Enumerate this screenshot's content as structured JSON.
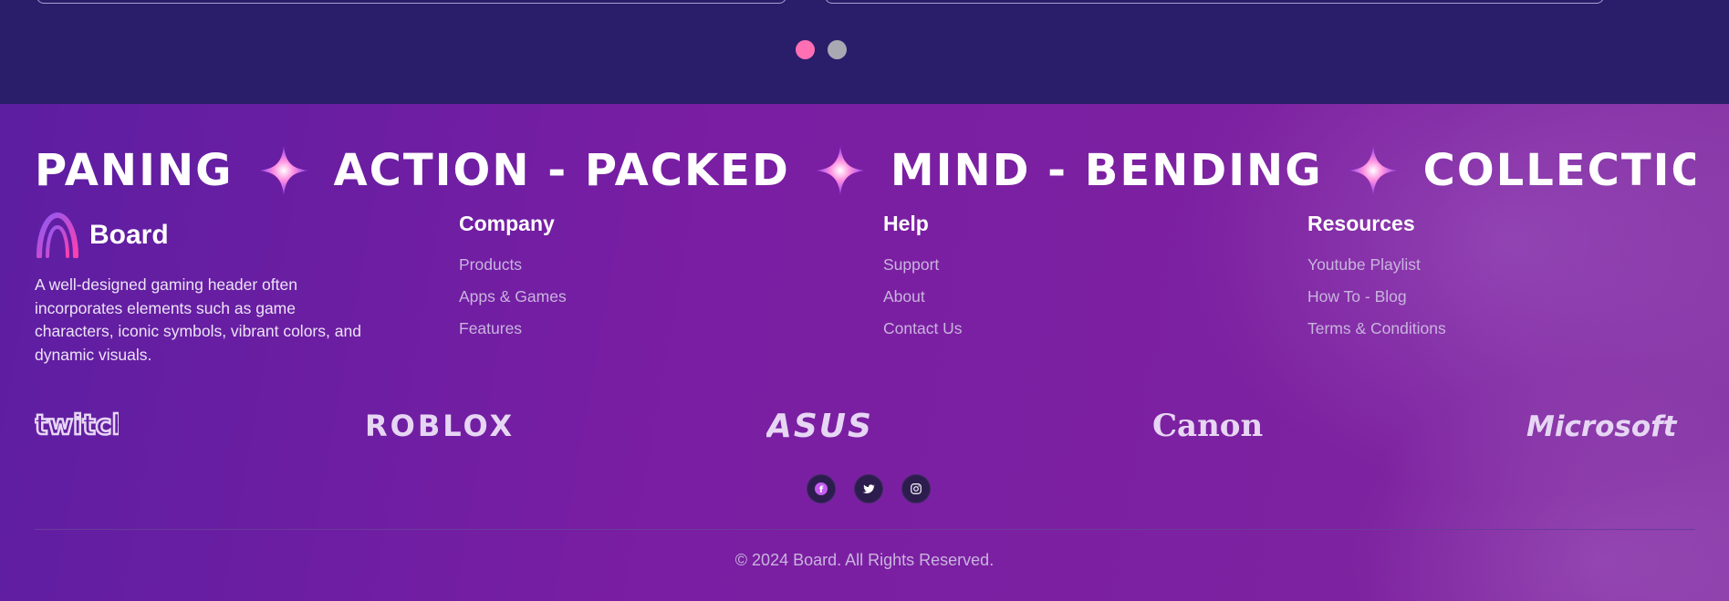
{
  "carousel": {
    "dots": [
      {
        "name": "slide-1",
        "color": "#ff6fb3",
        "active": true
      },
      {
        "name": "slide-2",
        "color": "#a9a9b3",
        "active": false
      }
    ]
  },
  "marquee": {
    "words": [
      "PANING",
      "ACTION - PACKED",
      "MIND - BENDING",
      "COLLECTIO"
    ],
    "separator_icon": "sparkle-star-icon"
  },
  "brand": {
    "logo_icon": "board-arch-logo-icon",
    "name": "Board",
    "description": "A well-designed gaming header often incorporates elements such as game characters, iconic symbols, vibrant colors, and dynamic visuals."
  },
  "columns": [
    {
      "title": "Company",
      "links": [
        "Products",
        "Apps & Games",
        "Features"
      ]
    },
    {
      "title": "Help",
      "links": [
        "Support",
        "About",
        "Contact Us"
      ]
    },
    {
      "title": "Resources",
      "links": [
        "Youtube Playlist",
        "How To - Blog",
        "Terms & Conditions"
      ]
    }
  ],
  "partners": [
    "twitch",
    "ROBLOX",
    "ASUS",
    "Canon",
    "Microsoft"
  ],
  "socials": [
    {
      "name": "facebook-icon"
    },
    {
      "name": "twitter-icon"
    },
    {
      "name": "instagram-icon"
    }
  ],
  "copyright": "© 2024 Board. All Rights Reserved.",
  "colors": {
    "top_bg": "#2a1e6a",
    "footer_bg_start": "#5d1ea2",
    "footer_bg_end": "#8a3aa8",
    "link": "#c9b4de",
    "accent_pink": "#ff6fb3"
  }
}
